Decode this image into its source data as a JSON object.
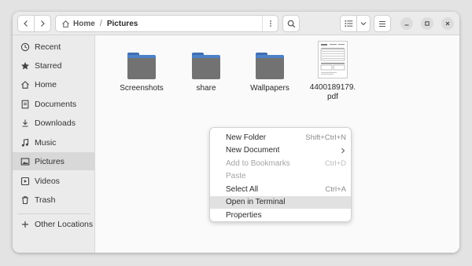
{
  "pathbar": {
    "home": "Home",
    "separator": "/",
    "current": "Pictures"
  },
  "sidebar": {
    "items": [
      {
        "label": "Recent",
        "icon": "clock-icon"
      },
      {
        "label": "Starred",
        "icon": "star-icon"
      },
      {
        "label": "Home",
        "icon": "home-icon"
      },
      {
        "label": "Documents",
        "icon": "document-icon"
      },
      {
        "label": "Downloads",
        "icon": "download-icon"
      },
      {
        "label": "Music",
        "icon": "music-icon"
      },
      {
        "label": "Pictures",
        "icon": "picture-icon",
        "active": true
      },
      {
        "label": "Videos",
        "icon": "video-icon"
      },
      {
        "label": "Trash",
        "icon": "trash-icon"
      }
    ],
    "other_locations": {
      "label": "Other Locations",
      "icon": "plus-icon"
    }
  },
  "files": [
    {
      "name": "Screenshots",
      "type": "folder"
    },
    {
      "name": "share",
      "type": "folder"
    },
    {
      "name": "Wallpapers",
      "type": "folder"
    },
    {
      "name_line1": "4400189179.",
      "name_line2": "pdf",
      "type": "pdf"
    }
  ],
  "context_menu": {
    "items": [
      {
        "label": "New Folder",
        "accel": "Shift+Ctrl+N"
      },
      {
        "label": "New Document",
        "submenu": true
      },
      {
        "label": "Add to Bookmarks",
        "accel": "Ctrl+D",
        "disabled": true
      },
      {
        "label": "Paste",
        "disabled": true
      },
      {
        "label": "Select All",
        "accel": "Ctrl+A"
      },
      {
        "label": "Open in Terminal",
        "highlighted": true
      },
      {
        "label": "Properties"
      }
    ]
  },
  "colors": {
    "folder_tab": "#3f6fb0",
    "folder_body": "#727272",
    "accent_highlight": "#e1e1e1"
  }
}
